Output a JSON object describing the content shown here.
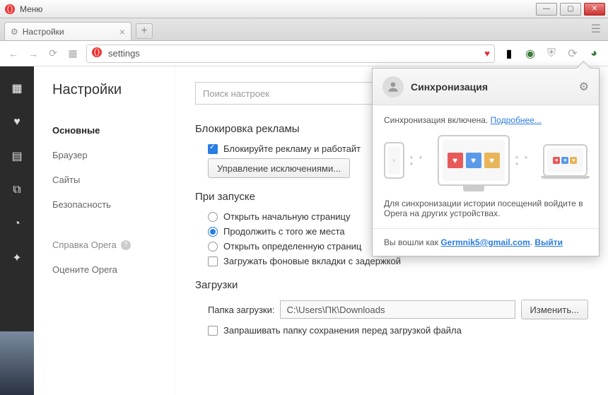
{
  "titlebar": {
    "menu": "Меню"
  },
  "tab": {
    "title": "Настройки"
  },
  "address": {
    "url": "settings"
  },
  "page": {
    "title": "Настройки",
    "search_placeholder": "Поиск настроек"
  },
  "sidebar": {
    "items": [
      "Основные",
      "Браузер",
      "Сайты",
      "Безопасность"
    ],
    "help": "Справка Opera",
    "rate": "Оцените Opera"
  },
  "sections": {
    "adblock": {
      "title": "Блокировка рекламы",
      "checkbox": "Блокируйте рекламу и работайт",
      "manage_btn": "Управление исключениями..."
    },
    "startup": {
      "title": "При запуске",
      "opt1": "Открыть начальную страницу",
      "opt2": "Продолжить с того же места",
      "opt3": "Открыть определенную страниц",
      "opt4": "Загружать фоновые вкладки с задержкой"
    },
    "downloads": {
      "title": "Загрузки",
      "label": "Папка загрузки:",
      "path": "C:\\Users\\ПК\\Downloads",
      "change": "Изменить...",
      "ask": "Запрашивать папку сохранения перед загрузкой файла"
    }
  },
  "sync": {
    "title": "Синхронизация",
    "enabled": "Синхронизация включена.",
    "learn_more": "Подробнее...",
    "hint": "Для синхронизации истории посещений войдите в Opera на других устройствах.",
    "signed_as": "Вы вошли как",
    "email": "Germnik5@gmail.com",
    "signout": "Выйти"
  }
}
